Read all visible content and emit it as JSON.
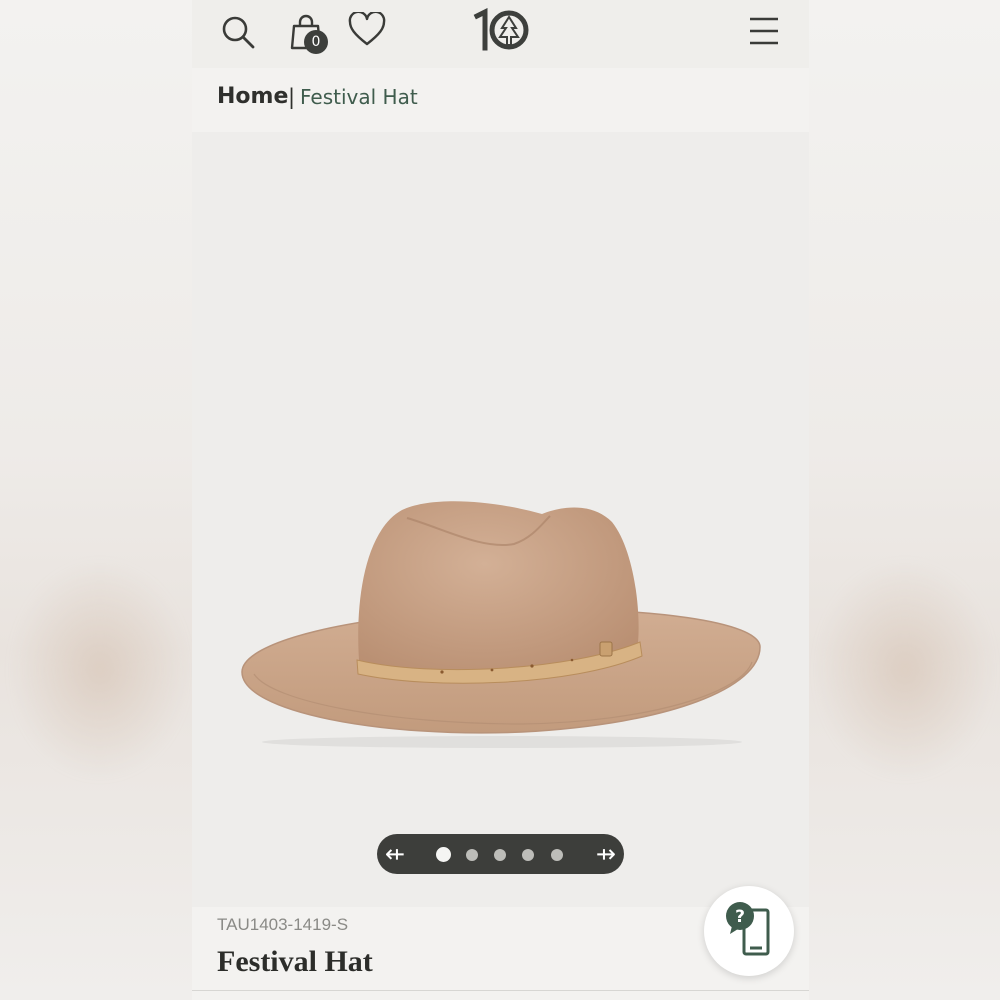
{
  "app": {
    "header": {
      "cart_count": "0",
      "icons": [
        "search-icon",
        "shopping-bag-icon",
        "heart-icon",
        "brand-logo",
        "menu-icon"
      ]
    },
    "breadcrumb": {
      "home": "Home",
      "separator": "|",
      "current": "Festival Hat"
    },
    "gallery": {
      "total_images": 5,
      "active_index": 0,
      "prev_icon": "arrow-left-icon",
      "next_icon": "arrow-right-icon"
    },
    "product": {
      "sku": "TAU1403-1419-S",
      "name": "Festival Hat"
    },
    "help": {
      "symbol": "?",
      "icon": "help-chat-icon"
    },
    "colors": {
      "accent_green": "#3f5c4d",
      "dark": "#3d3e3b",
      "hat_felt": "#c9a587",
      "band_cork": "#d8b384"
    }
  }
}
